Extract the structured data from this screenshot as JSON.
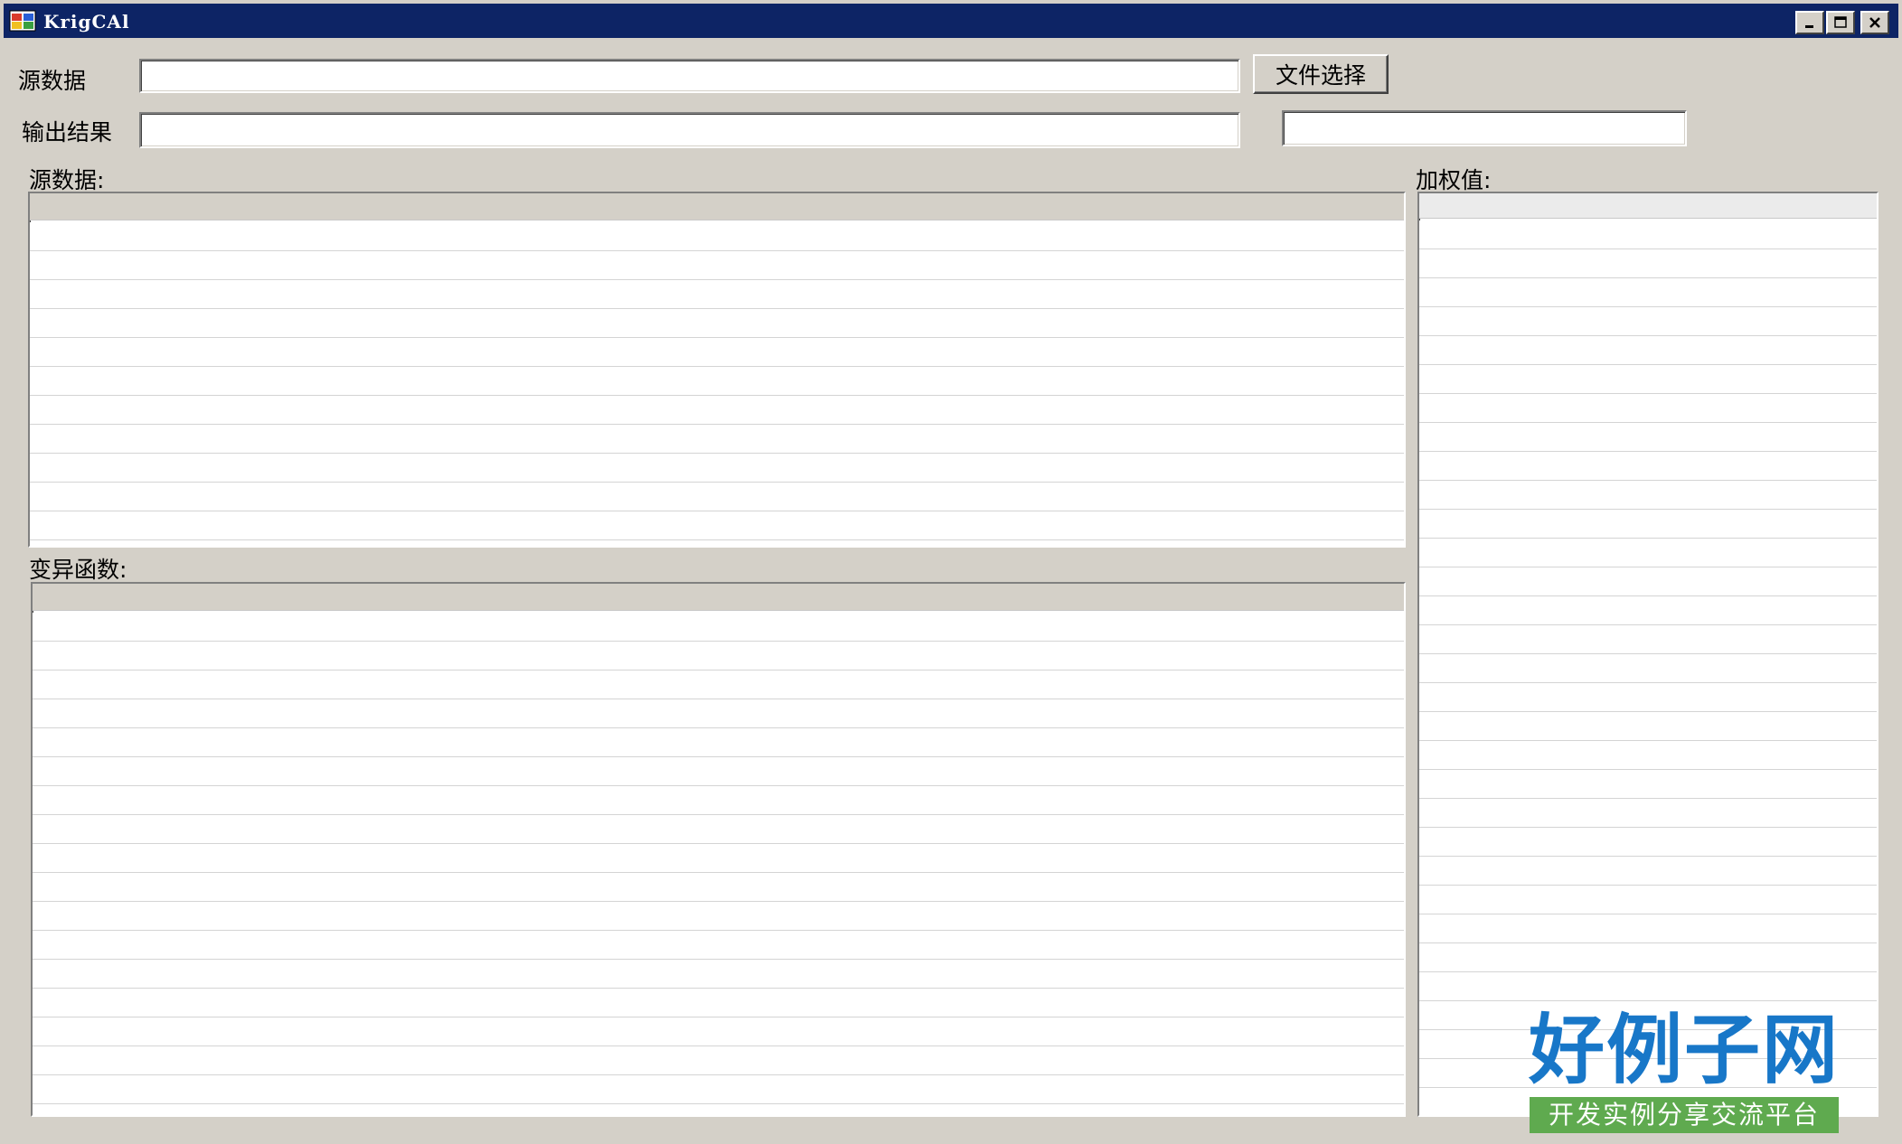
{
  "window": {
    "title": "KrigCAl"
  },
  "form": {
    "source_label": "源数据",
    "source_value": "",
    "file_button_label": "文件选择",
    "output_label": "输出结果",
    "output_value": "",
    "output_extra_value": ""
  },
  "panels": {
    "source_grid_label": "源数据:",
    "weights_grid_label": "加权值:",
    "variogram_grid_label": "变异函数:"
  },
  "watermark": {
    "brand_main": "好例子网",
    "brand_sub": "开发实例分享交流平台"
  }
}
